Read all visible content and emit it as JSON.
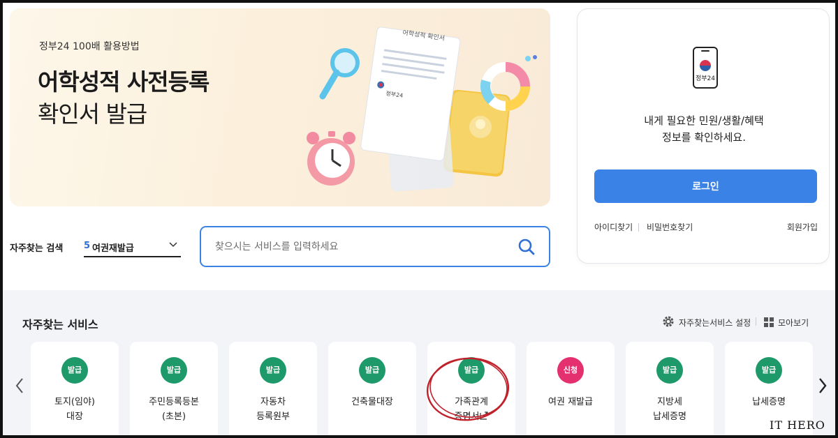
{
  "banner": {
    "subtitle": "정부24 100배 활용방법",
    "title_line1": "어학성적 사전등록",
    "title_line2": "확인서 발급",
    "art_doc_label": "어학성적 확인서",
    "art_brand": "정부24"
  },
  "login": {
    "brand": "정부24",
    "message_line1": "내게 필요한 민원/생활/혜택",
    "message_line2": "정보를 확인하세요.",
    "button": "로그인",
    "find_id": "아이디찾기",
    "find_pw": "비밀번호찾기",
    "join": "회원가입",
    "accent_color": "#3b82e6"
  },
  "search": {
    "label": "자주찾는 검색",
    "rank": "5",
    "keyword": "여권재발급",
    "placeholder": "찾으시는 서비스를 입력하세요"
  },
  "services": {
    "title": "자주찾는 서비스",
    "settings_label": "자주찾는서비스 설정",
    "view_all_label": "모아보기",
    "items": [
      {
        "badge": "발급",
        "line1": "토지(임야)",
        "line2": "대장",
        "badge_color": "#1e9a6a"
      },
      {
        "badge": "발급",
        "line1": "주민등록등본",
        "line2": "(초본)",
        "badge_color": "#1e9a6a"
      },
      {
        "badge": "발급",
        "line1": "자동차",
        "line2": "등록원부",
        "badge_color": "#1e9a6a"
      },
      {
        "badge": "발급",
        "line1": "건축물대장",
        "line2": "",
        "badge_color": "#1e9a6a"
      },
      {
        "badge": "발급",
        "line1": "가족관계",
        "line2": "증명서",
        "badge_color": "#1e9a6a"
      },
      {
        "badge": "신청",
        "line1": "여권 재발급",
        "line2": "",
        "badge_color": "#e5306f"
      },
      {
        "badge": "발급",
        "line1": "지방세",
        "line2": "납세증명",
        "badge_color": "#1e9a6a"
      },
      {
        "badge": "발급",
        "line1": "납세증명",
        "line2": "",
        "badge_color": "#1e9a6a"
      }
    ]
  },
  "watermark": "IT HERO"
}
